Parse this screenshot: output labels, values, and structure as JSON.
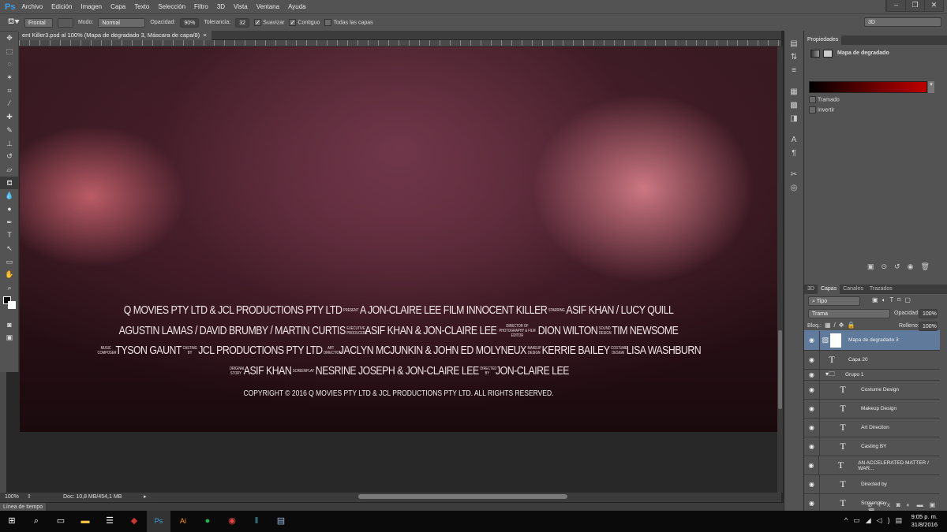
{
  "app": {
    "logo": "Ps",
    "menu": [
      "Archivo",
      "Edición",
      "Imagen",
      "Capa",
      "Texto",
      "Selección",
      "Filtro",
      "3D",
      "Vista",
      "Ventana",
      "Ayuda"
    ],
    "workspace": "3D"
  },
  "options": {
    "source": "Frontal",
    "mode_label": "Modo:",
    "mode": "Normal",
    "opacity_label": "Opacidad:",
    "opacity": "90%",
    "tolerance_label": "Tolerancia:",
    "tolerance": "32",
    "smooth": "Suavizar",
    "contiguous": "Contiguo",
    "all_layers": "Todas las capas"
  },
  "document": {
    "tab_title": "ent Killer3.psd al 100% (Mapa de degradado 3, Máscara de capa/8)",
    "close": "×"
  },
  "credits": {
    "l1": [
      "Q MOVIES PTY LTD & JCL PRODUCTIONS PTY LTD",
      "PRESENT",
      "A JON-CLAIRE LEE FILM INNOCENT KILLER",
      "STARRING",
      "ASIF KHAN / LUCY QUILL"
    ],
    "l2": [
      "AGUSTIN LAMAS / DAVID BRUMBY / MARTIN CURTIS",
      "EXECUTIVE PRODUCERS",
      "ASIF KHAN & JON-CLAIRE LEE",
      "DIRECTOR OF PHOTOGRAPHY & FILM EDITOR",
      "DION WILTON",
      "SOUND DESIGN",
      "TIM NEWSOME"
    ],
    "l3": [
      "MUSIC COMPOSER",
      "TYSON GAUNT",
      "CASTING BY",
      "JCL PRODUCTIONS PTY LTD",
      "ART DIRECTION",
      "JACLYN MCJUNKIN & JOHN ED MOLYNEUX",
      "MAKEUP DESIGN",
      "KERRIE BAILEY",
      "COSTUME DESIGN",
      "LISA WASHBURN"
    ],
    "l4": [
      "ORIGINAL STORY",
      "ASIF KHAN",
      "SCREENPLAY",
      "NESRINE JOSEPH & JON-CLAIRE LEE",
      "DIRECTED BY",
      "JON-CLAIRE LEE"
    ],
    "copyright": "COPYRIGHT © 2016 Q MOVIES PTY LTD & JCL PRODUCTIONS PTY LTD. ALL RIGHTS RESERVED."
  },
  "status": {
    "zoom": "100%",
    "doc": "Doc: 10,8 MB/454,1 MB"
  },
  "timeline_tab": "Línea de tiempo",
  "properties": {
    "tab": "Propiedades",
    "title": "Mapa de degradado",
    "dither": "Tramado",
    "reverse": "Invertir",
    "gradient_colors": [
      "#000000",
      "#c00000"
    ]
  },
  "layers": {
    "tabs": [
      "3D",
      "Capas",
      "Canales",
      "Trazados"
    ],
    "filter": "Tipo",
    "blend": "Trama",
    "opacity_label": "Opacidad:",
    "opacity": "100%",
    "lock_label": "Bloq.:",
    "fill_label": "Relleno:",
    "fill": "100%",
    "items": [
      {
        "name": "Mapa de degradado 3",
        "type": "adjustment"
      },
      {
        "name": "Capa 20",
        "type": "text"
      },
      {
        "name": "Grupo 1",
        "type": "group"
      },
      {
        "name": "Costume Design",
        "type": "text"
      },
      {
        "name": "Makeup Design",
        "type": "text"
      },
      {
        "name": "Art Direction",
        "type": "text"
      },
      {
        "name": "Casting BY",
        "type": "text"
      },
      {
        "name": "AN ACCELERATED MATTER / WAR...",
        "type": "text"
      },
      {
        "name": "Directed  by",
        "type": "text"
      },
      {
        "name": "Screenplay",
        "type": "text"
      }
    ]
  },
  "taskbar": {
    "time": "9:05 p. m.",
    "date": "31/8/2016"
  }
}
